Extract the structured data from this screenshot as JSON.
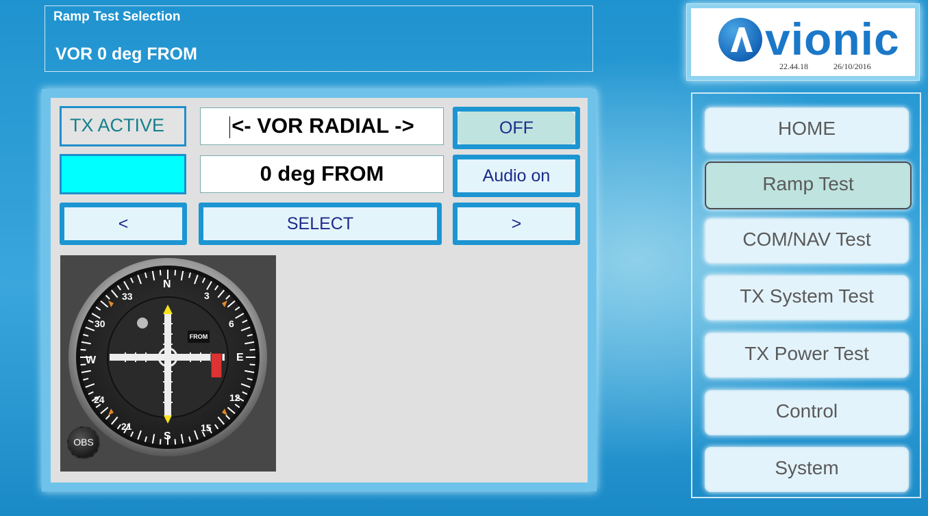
{
  "header": {
    "title": "Ramp Test Selection",
    "selection": "VOR 0 deg FROM"
  },
  "logo": {
    "brand": "vionic",
    "time": "22.44.18",
    "date": "26/10/2016"
  },
  "controls": {
    "tx_label": "TX ACTIVE",
    "tx_indicator_color": "#00ffff",
    "mode_field": "<- VOR RADIAL ->",
    "value_field": "0 deg FROM",
    "off_button": "OFF",
    "audio_button": "Audio on",
    "prev_button": "<",
    "select_button": "SELECT",
    "next_button": ">"
  },
  "indicator": {
    "flag": "FROM",
    "obs_knob": "OBS",
    "cardinals": [
      "N",
      "E",
      "S",
      "W"
    ],
    "numbers": [
      "3",
      "6",
      "12",
      "15",
      "21",
      "24",
      "30",
      "33"
    ]
  },
  "nav": {
    "items": [
      {
        "label": "HOME",
        "active": false
      },
      {
        "label": "Ramp Test",
        "active": true
      },
      {
        "label": "COM/NAV Test",
        "active": false
      },
      {
        "label": "TX System Test",
        "active": false
      },
      {
        "label": "TX Power Test",
        "active": false
      },
      {
        "label": "Control",
        "active": false
      },
      {
        "label": "System",
        "active": false
      }
    ]
  },
  "colors": {
    "accent": "#1c95d2",
    "active_button": "#bfe3de",
    "button_text": "#1b2b8a"
  }
}
